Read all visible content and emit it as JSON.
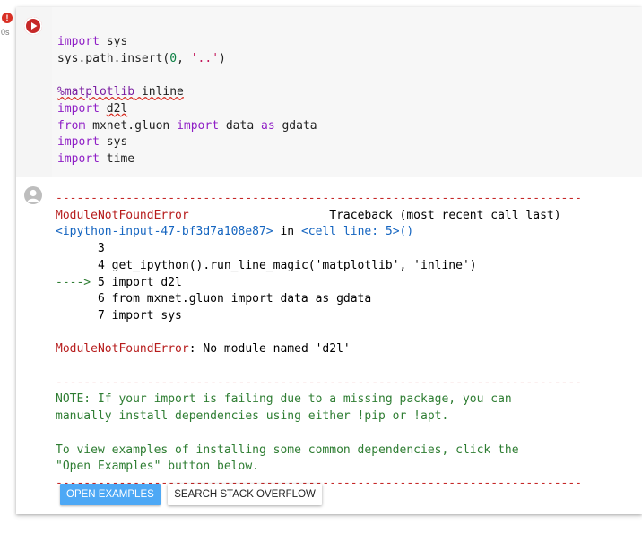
{
  "status": {
    "badge": "!",
    "exec_time": "0s"
  },
  "code": {
    "line1": {
      "kw": "import",
      "rest": " sys"
    },
    "line2": {
      "pre": "sys.path.insert(",
      "num": "0",
      "mid": ", ",
      "str": "'..'",
      "post": ")"
    },
    "line4": {
      "magic": "%matplotlib",
      "rest": " inline"
    },
    "line5": {
      "kw": "import",
      "mod": "d2l"
    },
    "line6": {
      "kw1": "from",
      "mod": " mxnet.gluon ",
      "kw2": "import",
      "mid": " data ",
      "kw3": "as",
      "rest": " gdata"
    },
    "line7": {
      "kw": "import",
      "rest": " sys"
    },
    "line8": {
      "kw": "import",
      "rest": " time"
    }
  },
  "output": {
    "rule": "---------------------------------------------------------------------------",
    "error_name": "ModuleNotFoundError",
    "traceback_label": "Traceback (most recent call last)",
    "input_link": "<ipython-input-47-bf3d7a108e87>",
    "in_text": " in ",
    "cell_ref": "<cell line: 5>()",
    "tb_line3": "      3",
    "tb_line4_num": "      4 ",
    "tb_line4_code": "get_ipython().run_line_magic('matplotlib', 'inline')",
    "tb_arrow": "----> ",
    "tb_line5": "5 import d2l",
    "tb_line6": "      6 from mxnet.gluon import data as gdata",
    "tb_line7": "      7 import sys",
    "error_message": ": No module named 'd2l'",
    "note_line1": "NOTE: If your import is failing due to a missing package, you can",
    "note_line2": "manually install dependencies using either !pip or !apt.",
    "note_line3": "To view examples of installing some common dependencies, click the",
    "note_line4": "\"Open Examples\" button below."
  },
  "buttons": {
    "open_examples": "OPEN EXAMPLES",
    "search_stack_overflow": "SEARCH STACK OVERFLOW"
  },
  "colors": {
    "error_red": "#c62828",
    "link_blue": "#1565c0",
    "note_green": "#2e7d32",
    "button_blue": "#4da8f5"
  }
}
